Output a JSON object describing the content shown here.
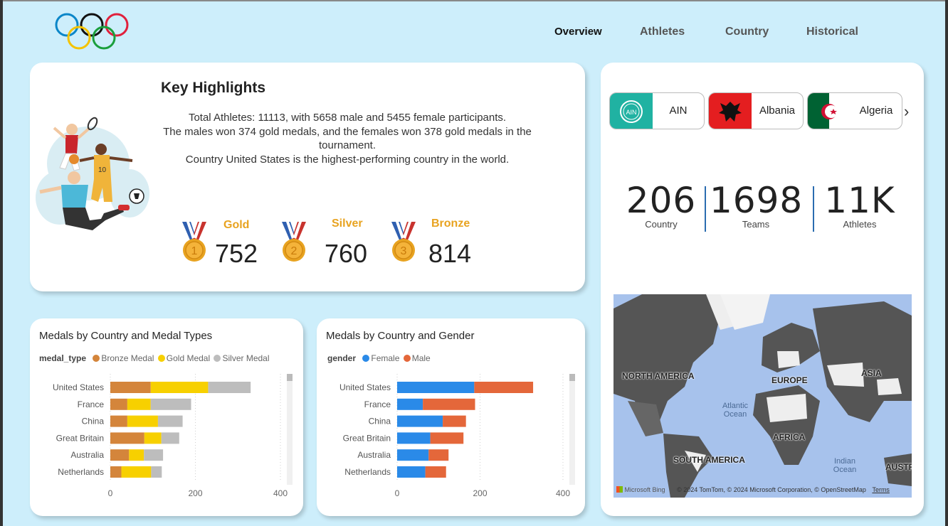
{
  "nav": {
    "items": [
      "Overview",
      "Athletes",
      "Country",
      "Historical"
    ],
    "active": "Overview"
  },
  "highlights": {
    "title": "Key Highlights",
    "line1": "Total Athletes: 11113, with 5658 male and 5455 female participants.",
    "line2": "The males won 374 gold medals, and the females won 378 gold medals in the tournament.",
    "line3": "Country United States is the highest-performing country in the world.",
    "medals": [
      {
        "label": "Gold",
        "value": "752",
        "rank": "1"
      },
      {
        "label": "Silver",
        "value": "760",
        "rank": "2"
      },
      {
        "label": "Bronze",
        "value": "814",
        "rank": "3"
      }
    ]
  },
  "countries": {
    "tiles": [
      "AIN",
      "Albania",
      "Algeria"
    ],
    "flag_badge": "AIN"
  },
  "kpis": [
    {
      "value": "206",
      "label": "Country"
    },
    {
      "value": "1698",
      "label": "Teams"
    },
    {
      "value": "11K",
      "label": "Athletes"
    }
  ],
  "map": {
    "labels": [
      "NORTH AMERICA",
      "EUROPE",
      "ASIA",
      "AFRICA",
      "SOUTH AMERICA",
      "AUSTR"
    ],
    "oceans": [
      "Atlantic Ocean",
      "Indian Ocean"
    ],
    "attribution": "© 2024 TomTom, © 2024 Microsoft Corporation, © OpenStreetMap",
    "terms": "Terms",
    "bing": "Microsoft Bing"
  },
  "colors": {
    "bronze": "#d4853b",
    "gold": "#f7d000",
    "silver": "#bdbdbd",
    "female": "#2a8ae8",
    "male": "#e4673a",
    "accent": "#e8a320"
  },
  "chart_data": [
    {
      "type": "bar",
      "orientation": "horizontal",
      "stacked": true,
      "title": "Medals by Country and Medal Types",
      "legend_title": "medal_type",
      "categories": [
        "United States",
        "France",
        "China",
        "Great Britain",
        "Australia",
        "Netherlands"
      ],
      "series": [
        {
          "name": "Bronze Medal",
          "values": [
            95,
            40,
            40,
            80,
            44,
            26
          ]
        },
        {
          "name": "Gold Medal",
          "values": [
            135,
            55,
            72,
            40,
            35,
            70
          ]
        },
        {
          "name": "Silver Medal",
          "values": [
            100,
            95,
            58,
            42,
            45,
            25
          ]
        }
      ],
      "xticks": [
        "0",
        "200",
        "400"
      ],
      "xlim": [
        0,
        400
      ]
    },
    {
      "type": "bar",
      "orientation": "horizontal",
      "stacked": true,
      "title": "Medals by Country and Gender",
      "legend_title": "gender",
      "categories": [
        "United States",
        "France",
        "China",
        "Great Britain",
        "Australia",
        "Netherlands"
      ],
      "series": [
        {
          "name": "Female",
          "values": [
            186,
            62,
            110,
            80,
            76,
            68
          ]
        },
        {
          "name": "Male",
          "values": [
            142,
            126,
            56,
            80,
            48,
            50
          ]
        }
      ],
      "xticks": [
        "0",
        "200",
        "400"
      ],
      "xlim": [
        0,
        400
      ]
    }
  ]
}
